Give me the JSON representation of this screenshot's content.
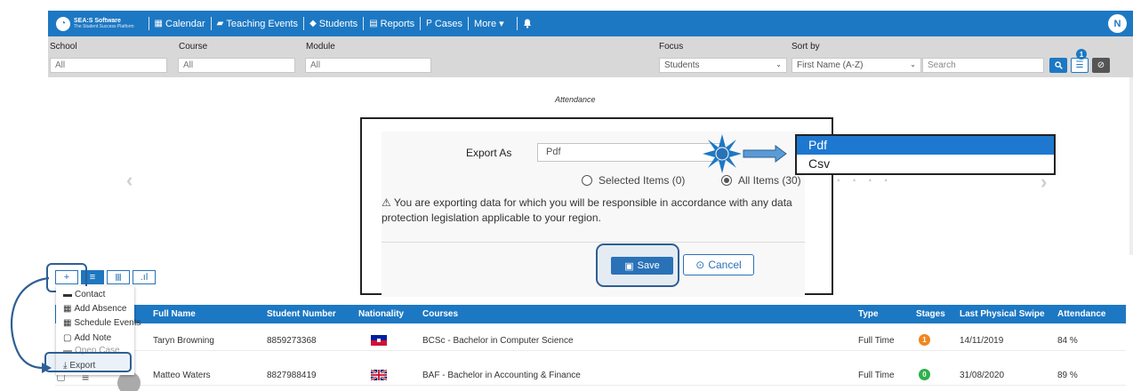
{
  "nav": {
    "logo_line1": "SEA:S Software",
    "logo_line2": "The Student Success Platform",
    "items": [
      {
        "icon": "▦",
        "label": "Calendar"
      },
      {
        "icon": "▰",
        "label": "Teaching Events"
      },
      {
        "icon": "◆",
        "label": "Students"
      },
      {
        "icon": "▤",
        "label": "Reports"
      },
      {
        "icon": "P",
        "label": "Cases"
      },
      {
        "icon": "",
        "label": "More ▾"
      }
    ],
    "avatar_initial": "N"
  },
  "filters": {
    "school_label": "School",
    "school_value": "All",
    "course_label": "Course",
    "course_value": "All",
    "module_label": "Module",
    "module_value": "All",
    "focus_label": "Focus",
    "focus_value": "Students",
    "sortby_label": "Sort by",
    "sortby_value": "First Name (A-Z)",
    "search_placeholder": "Search",
    "filter_count": "1"
  },
  "attendance_title": "Attendance",
  "export_modal": {
    "export_as_label": "Export As",
    "export_as_value": "Pdf",
    "radio_selected": "Selected Items (0)",
    "radio_all": "All Items (30)",
    "warning": "You are exporting data for which you will be responsible in accordance with any data protection legislation applicable to your region.",
    "save_label": "Save",
    "cancel_label": "Cancel"
  },
  "format_dropdown": {
    "options": [
      "Pdf",
      "Csv"
    ],
    "selected": "Pdf"
  },
  "context_menu": {
    "items": [
      "Contact",
      "Add Absence",
      "Schedule Events",
      "Add Note",
      "Open Case",
      "Export"
    ]
  },
  "count_fragment": "30",
  "table": {
    "headers": [
      "Full Name",
      "Student Number",
      "Nationality",
      "Courses",
      "Type",
      "Stages",
      "Last Physical Swipe",
      "Attendance"
    ],
    "rows": [
      {
        "name": "Taryn Browning",
        "number": "8859273368",
        "course": "BCSc - Bachelor in Computer Science",
        "type": "Full Time",
        "stage": "1",
        "stage_color": "#f0861e",
        "swipe": "14/11/2019",
        "attendance": "84 %"
      },
      {
        "name": "Matteo Waters",
        "number": "8827988419",
        "course": "BAF - Bachelor in Accounting & Finance",
        "type": "Full Time",
        "stage": "0",
        "stage_color": "#2db04a",
        "swipe": "31/08/2020",
        "attendance": "89 %"
      }
    ]
  },
  "colors": {
    "brand": "#1d78c3",
    "highlight": "#2e5f93",
    "dropdown_selected": "#1e78d0"
  }
}
